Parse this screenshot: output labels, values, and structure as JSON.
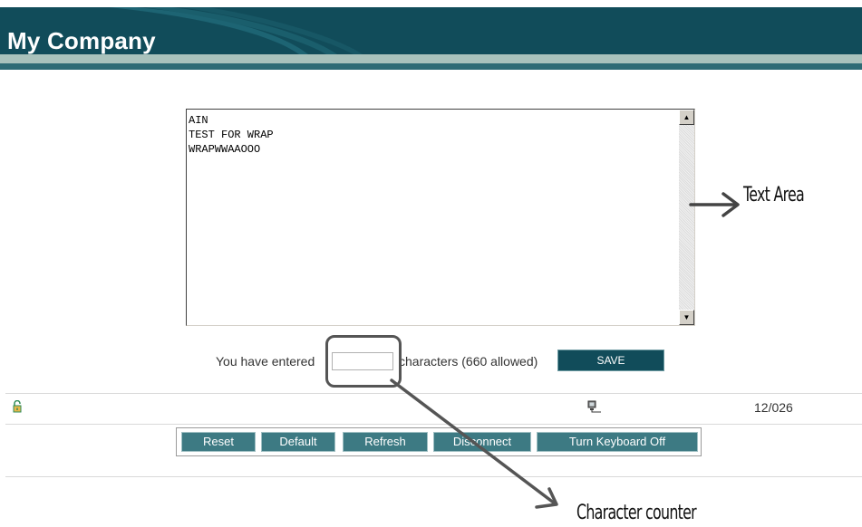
{
  "header": {
    "title": "My Company"
  },
  "editor": {
    "lines": [
      "AIN",
      "TEST FOR WRAP",
      "WRAPWWAAOOO"
    ],
    "scroll_up_icon": "up-arrow-icon",
    "scroll_down_icon": "down-arrow-icon"
  },
  "counter": {
    "label_before": "You have entered",
    "value": "",
    "label_after": "characters (660 allowed)",
    "save_label": "SAVE"
  },
  "status": {
    "lock_icon": "unlock-icon",
    "network_icon": "network-computer-icon",
    "count": "12/026"
  },
  "toolbar": {
    "buttons": [
      {
        "label": "Reset"
      },
      {
        "label": "Default"
      },
      {
        "label": "Refresh"
      },
      {
        "label": "Disconnect"
      },
      {
        "label": "Turn Keyboard Off"
      }
    ]
  },
  "annotations": {
    "text_area": "Text Area",
    "character_counter": "Character counter"
  },
  "colors": {
    "brand": "#114c5a",
    "button": "#3d7a83",
    "stripe": "#a9c2bc"
  }
}
